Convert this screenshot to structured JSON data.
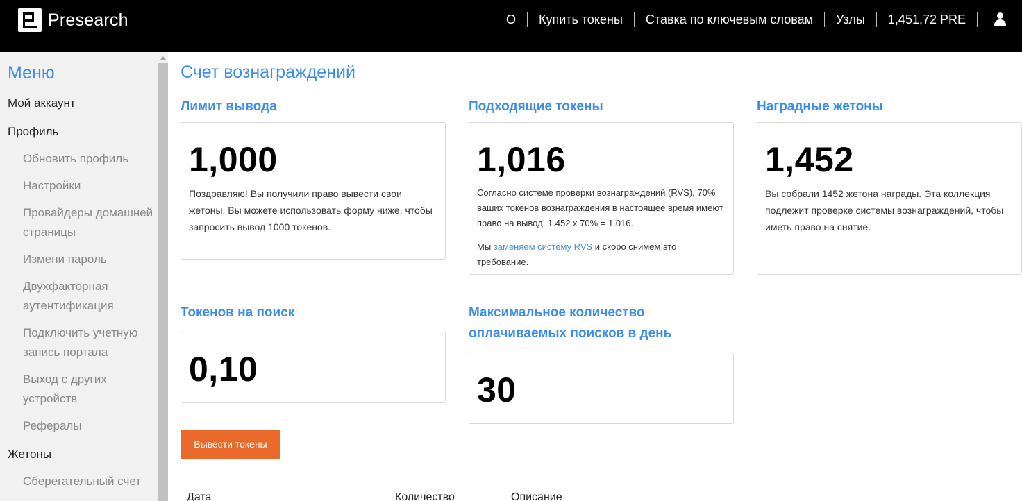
{
  "header": {
    "logo_text": "Presearch",
    "nav": [
      {
        "label": "О"
      },
      {
        "label": "Купить токены"
      },
      {
        "label": "Ставка по ключевым словам"
      },
      {
        "label": "Узлы"
      },
      {
        "label": "1,451,72 PRE"
      }
    ],
    "user_icon": "user-icon"
  },
  "sidebar": {
    "title": "Меню",
    "my_account": "Мой аккаунт",
    "profile": "Профиль",
    "profile_items": [
      "Обновить профиль",
      "Настройки",
      "Провайдеры домашней страницы",
      "Измени пароль",
      "Двухфакторная аутентификация",
      "Подключить учетную запись портала",
      "Выход с других устройств",
      "Рефералы"
    ],
    "tokens": "Жетоны",
    "tokens_items": [
      "Сберегательный счет"
    ]
  },
  "main": {
    "title": "Счет вознаграждений",
    "cards": {
      "limit": {
        "title": "Лимит вывода",
        "value": "1,000",
        "desc": "Поздравляю! Вы получили право вывести свои жетоны. Вы можете использовать форму ниже, чтобы запросить вывод 1000 токенов."
      },
      "eligible": {
        "title": "Подходящие токены",
        "value": "1,016",
        "desc": "Согласно системе проверки вознаграждений (RVS), 70% ваших токенов вознаграждения в настоящее время имеют право на вывод. 1.452 x 70% = 1.016.",
        "note_prefix": "Мы",
        "note_link": "заменяем систему RVS",
        "note_suffix": "и скоро снимем это требование."
      },
      "reward": {
        "title": "Наградные жетоны",
        "value": "1,452",
        "desc": "Вы собрали 1452 жетона награды. Эта коллекция подлежит проверке системы вознаграждений, чтобы иметь право на снятие."
      },
      "per_search": {
        "title": "Токенов на поиск",
        "value": "0,10"
      },
      "max_searches": {
        "title": "Максимальное количество оплачиваемых поисков в день",
        "value": "30"
      }
    },
    "withdraw_button": "Вывести токены",
    "table_headers": [
      "Дата",
      "Количество",
      "Описание"
    ]
  },
  "colors": {
    "accent": "#3c8ee8",
    "button": "#ea6a2c",
    "header_bg": "#000000"
  }
}
